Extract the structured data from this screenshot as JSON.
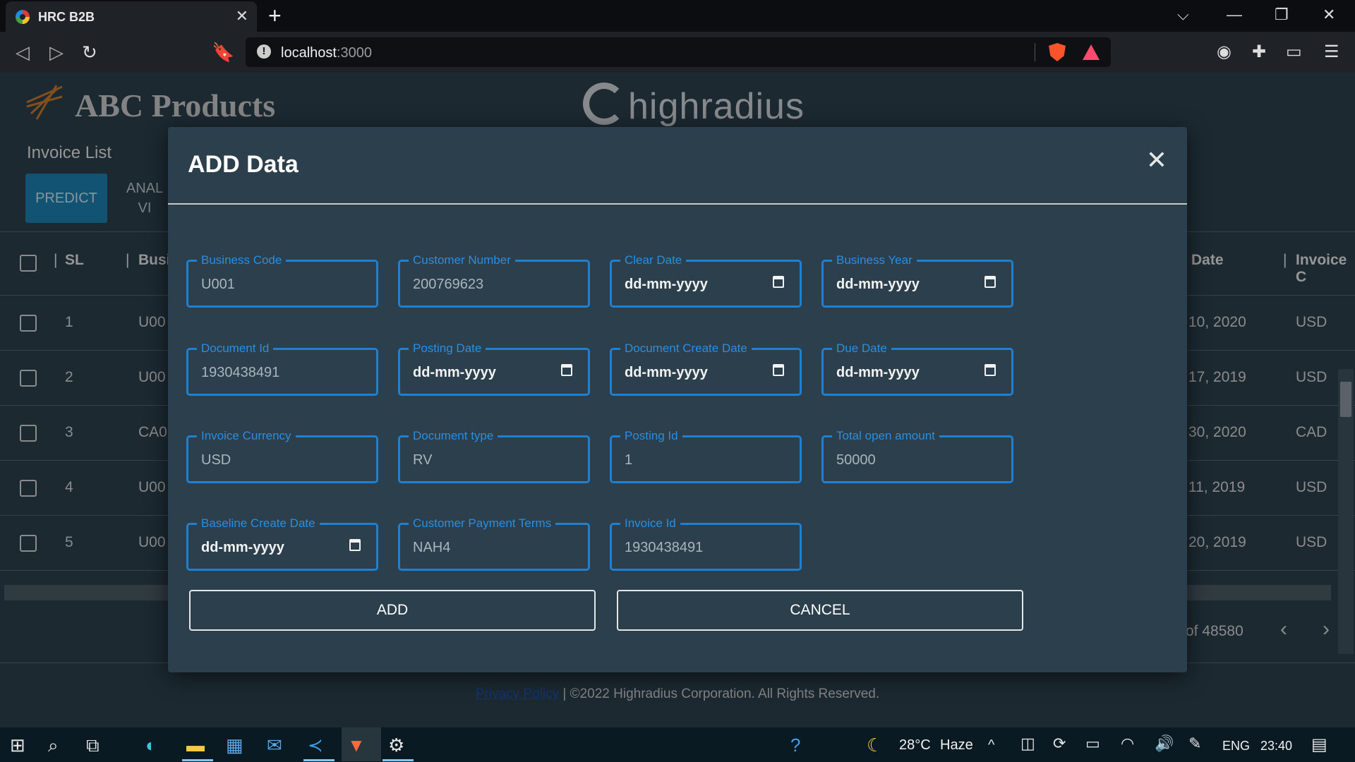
{
  "browser": {
    "tab_title": "HRC B2B",
    "url_host": "localhost",
    "url_port": ":3000"
  },
  "app": {
    "brand": "ABC Products",
    "partner_logo": "highradius",
    "section_title": "Invoice List",
    "predict_label": "PREDICT",
    "analytics_label_line1": "ANAL",
    "analytics_label_line2": "VI",
    "columns": {
      "sl": "SL",
      "business": "Busi",
      "date": "Date",
      "invoice": "Invoice C"
    },
    "rows": [
      {
        "sl": "1",
        "code": "U00",
        "date": "10, 2020",
        "cur": "USD"
      },
      {
        "sl": "2",
        "code": "U00",
        "date": "17, 2019",
        "cur": "USD"
      },
      {
        "sl": "3",
        "code": "CA0",
        "date": "30, 2020",
        "cur": "CAD"
      },
      {
        "sl": "4",
        "code": "U00",
        "date": "11, 2019",
        "cur": "USD"
      },
      {
        "sl": "5",
        "code": "U00",
        "date": "20, 2019",
        "cur": "USD"
      }
    ],
    "pagination_text": "of 48580",
    "footer_link": "Privacy Policy",
    "footer_text": " | ©2022 Highradius Corporation. All Rights Reserved."
  },
  "modal": {
    "title": "ADD Data",
    "fields": [
      {
        "label": "Business Code",
        "value": "U001"
      },
      {
        "label": "Customer Number",
        "value": "200769623"
      },
      {
        "label": "Clear Date",
        "value": "dd-mm-yyyy"
      },
      {
        "label": "Business Year",
        "value": "dd-mm-yyyy"
      },
      {
        "label": "Document Id",
        "value": "1930438491"
      },
      {
        "label": "Posting Date",
        "value": "dd-mm-yyyy"
      },
      {
        "label": "Document Create Date",
        "value": "dd-mm-yyyy"
      },
      {
        "label": "Due Date",
        "value": "dd-mm-yyyy"
      },
      {
        "label": "Invoice Currency",
        "value": "USD"
      },
      {
        "label": "Document type",
        "value": "RV"
      },
      {
        "label": "Posting Id",
        "value": "1"
      },
      {
        "label": "Total open amount",
        "value": "50000"
      },
      {
        "label": "Baseline Create Date",
        "value": "dd-mm-yyyy"
      },
      {
        "label": "Customer Payment Terms",
        "value": "NAH4"
      },
      {
        "label": "Invoice Id",
        "value": "1930438491"
      }
    ],
    "add_label": "ADD",
    "cancel_label": "CANCEL"
  },
  "taskbar": {
    "temperature": "28°C",
    "weather": "Haze",
    "language": "ENG",
    "time": "23:40"
  },
  "colors": {
    "background": "#2b3f4c",
    "accent": "#1f7fd1",
    "predict": "#1c7fb0"
  }
}
